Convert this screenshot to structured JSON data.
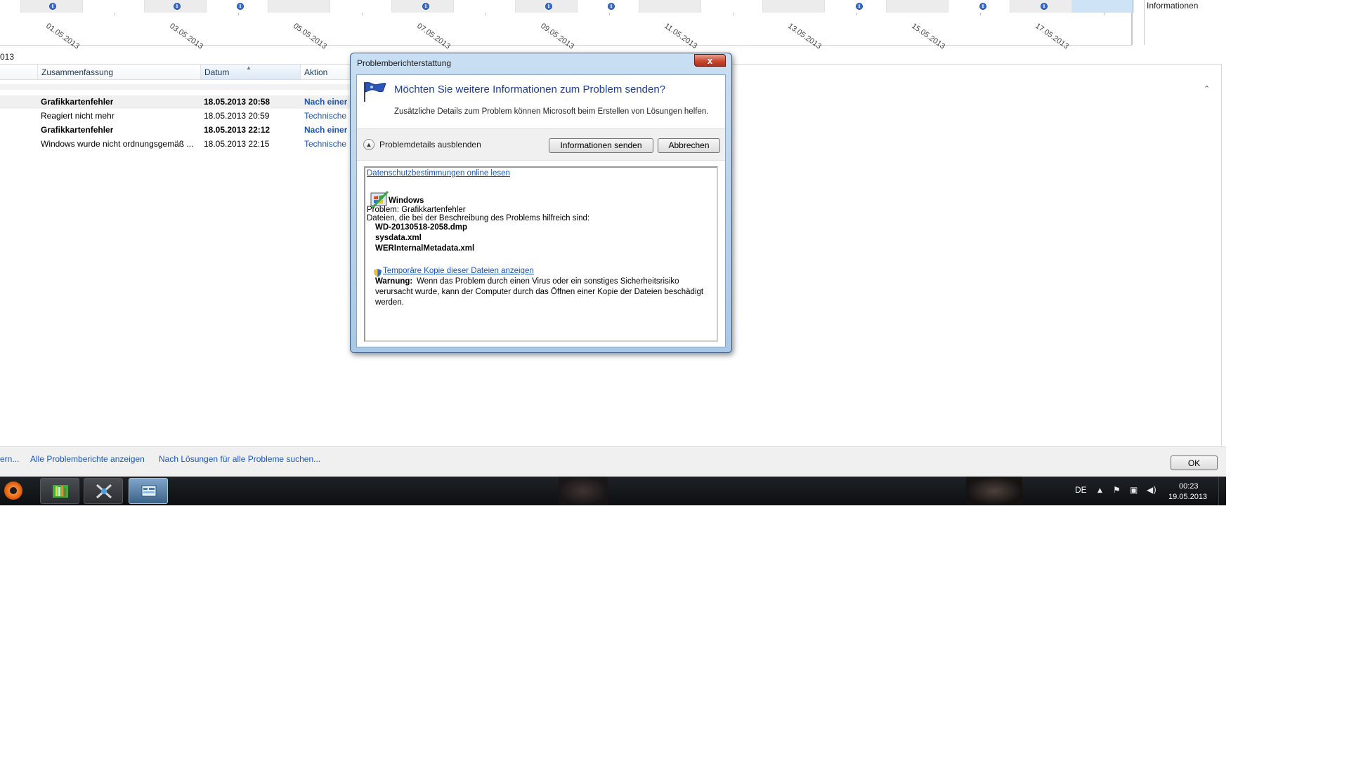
{
  "timeline": {
    "dates": [
      "01.05.2013",
      "03.05.2013",
      "05.05.2013",
      "07.05.2013",
      "09.05.2013",
      "11.05.2013",
      "13.05.2013",
      "15.05.2013",
      "17.05.2013"
    ],
    "legend_label": "Informationen",
    "info_icon": "info-icon"
  },
  "period_label": "013",
  "list": {
    "columns": [
      "Zusammenfassung",
      "Datum",
      "Aktion"
    ],
    "rows": [
      {
        "summary": "Grafikkartenfehler",
        "date": "18.05.2013 20:58",
        "action": "Nach einer",
        "bold": true
      },
      {
        "summary": "Reagiert nicht mehr",
        "date": "18.05.2013 20:59",
        "action": "Technische",
        "bold": false
      },
      {
        "summary": "Grafikkartenfehler",
        "date": "18.05.2013 22:12",
        "action": "Nach einer",
        "bold": true
      },
      {
        "summary": "Windows wurde nicht ordnungsgemäß ...",
        "date": "18.05.2013 22:15",
        "action": "Technische",
        "bold": false
      }
    ]
  },
  "bottom_bar": {
    "link_partial": "ern...",
    "link_all_reports": "Alle Problemberichte anzeigen",
    "link_search_solutions": "Nach Lösungen für alle Probleme suchen...",
    "ok_label": "OK"
  },
  "taskbar": {
    "language": "DE",
    "time": "00:23",
    "date": "19.05.2013",
    "tray_icons": [
      "show-hidden-icons-arrow",
      "action-center-flag-icon",
      "network-icon",
      "volume-icon"
    ]
  },
  "dialog": {
    "title": "Problemberichterstattung",
    "close_label": "x",
    "heading": "Möchten Sie weitere Informationen zum Problem senden?",
    "subtext": "Zusätzliche Details zum Problem können Microsoft beim Erstellen von Lösungen helfen.",
    "toggle_label": "Problemdetails ausblenden",
    "send_label": "Informationen senden",
    "cancel_label": "Abbrechen",
    "details": {
      "privacy_link": "Datenschutzbestimmungen online lesen",
      "app_name": "Windows",
      "problem": "Problem: Grafikkartenfehler",
      "files_intro": "Dateien, die bei der Beschreibung des Problems hilfreich sind:",
      "files": [
        "WD-20130518-2058.dmp",
        "sysdata.xml",
        "WERInternalMetadata.xml"
      ],
      "temp_copy_link": "Temporäre Kopie dieser Dateien anzeigen",
      "warning_label": "Warnung:",
      "warning_line1": "Wenn das Problem durch einen Virus oder ein sonstiges Sicherheitsrisiko",
      "warning_line2": "verursacht wurde, kann der Computer durch das Öffnen einer Kopie der Dateien beschädigt",
      "warning_line3": "werden."
    }
  }
}
